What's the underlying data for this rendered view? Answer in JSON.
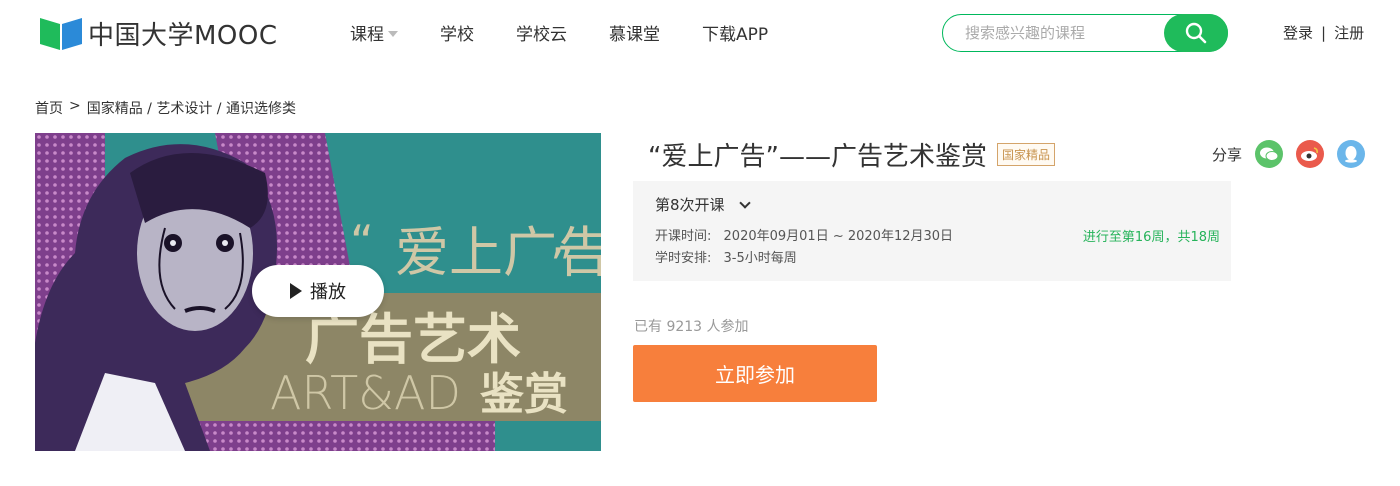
{
  "brand": {
    "name": "中国大学MOOC",
    "green": "#1fbb5b",
    "blue": "#2b8ad8"
  },
  "nav": [
    {
      "label": "课程",
      "has_dropdown": true
    },
    {
      "label": "学校"
    },
    {
      "label": "学校云"
    },
    {
      "label": "慕课堂"
    },
    {
      "label": "下载APP"
    }
  ],
  "search": {
    "placeholder": "搜索感兴趣的课程",
    "icon": "search-icon"
  },
  "auth": {
    "login": "登录",
    "separator": "|",
    "register": "注册"
  },
  "breadcrumb": {
    "home": "首页",
    "arrow": ">",
    "path": "国家精品 / 艺术设计 / 通识选修类"
  },
  "cover": {
    "quote_open": "“",
    "headline_top": "爱上广告",
    "quote_close": "”",
    "headline_main": "广告艺术",
    "headline_en": "ART&AD",
    "headline_end": "鉴赏",
    "play_label": "播放"
  },
  "course": {
    "title": "“爱上广告”——广告艺术鉴赏",
    "badge": "国家精品",
    "share_label": "分享",
    "share_icons": [
      "wechat-icon",
      "weibo-icon",
      "qq-icon"
    ]
  },
  "term": {
    "current": "第8次开课",
    "date_label": "开课时间:",
    "date_value": "2020年09月01日 ~ 2020年12月30日",
    "schedule_label": "学时安排:",
    "schedule_value": "3-5小时每周",
    "progress": "进行至第16周，共18周"
  },
  "enroll": {
    "count_text": "已有 9213 人参加",
    "button": "立即参加",
    "button_color": "#f77f3c"
  }
}
